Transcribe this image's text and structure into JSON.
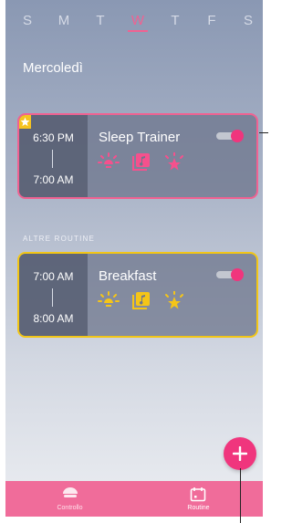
{
  "week": {
    "days": [
      "S",
      "M",
      "T",
      "W",
      "T",
      "F",
      "S"
    ],
    "selected_index": 3
  },
  "day_title": "Mercoledì",
  "featured_routine": {
    "start": "6:30 PM",
    "end": "7:00 AM",
    "name": "Sleep Trainer",
    "enabled": true,
    "favorite": true,
    "border_color": "#f06292",
    "icons": [
      "light-icon",
      "music-icon",
      "star-sparkle-icon"
    ],
    "icon_color": "#f5518d"
  },
  "other_section_label": "ALTRE ROUTINE",
  "other_routines": [
    {
      "start": "7:00 AM",
      "end": "8:00 AM",
      "name": "Breakfast",
      "enabled": true,
      "border_color": "#f2c616",
      "icons": [
        "light-icon",
        "music-icon",
        "star-sparkle-icon"
      ],
      "icon_color": "#f5c518"
    }
  ],
  "add_button_icon": "plus-icon",
  "tabs": [
    {
      "label": "Controllo",
      "icon": "lamp-icon",
      "active": false
    },
    {
      "label": "Routine",
      "icon": "calendar-icon",
      "active": true
    }
  ],
  "colors": {
    "accent": "#f0357d",
    "tabbar": "#f06c9a",
    "yellow": "#f2c616"
  }
}
